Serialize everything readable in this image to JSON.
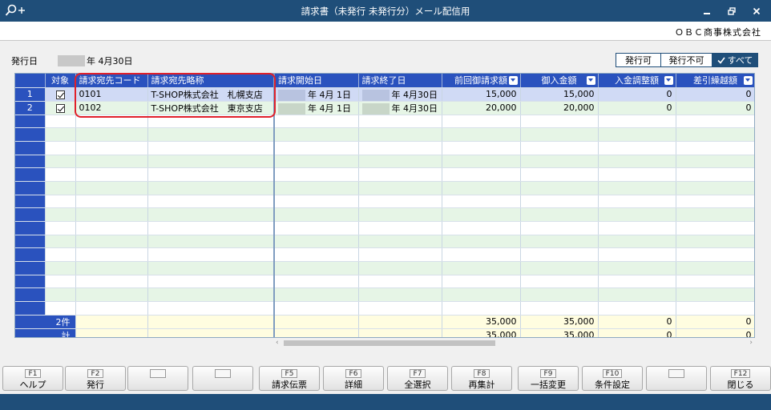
{
  "window": {
    "title": "請求書（未発行 未発行分）メール配信用",
    "company": "ＯＢＣ商事株式会社"
  },
  "issue_date": {
    "label": "発行日",
    "value": "年 4月30日"
  },
  "filters": [
    "発行可",
    "発行不可",
    "すべて"
  ],
  "grid": {
    "columns": [
      "対象",
      "請求宛先コード",
      "請求宛先略称",
      "請求開始日",
      "請求終了日",
      "前回御請求額",
      "御入金額",
      "入金調整額",
      "差引繰越額"
    ],
    "rows": [
      {
        "no": "1",
        "code": "0101",
        "name": "T-SHOP株式会社　札幌支店",
        "start": "年  4月  1日",
        "end": "年  4月30日",
        "prev": "15,000",
        "paid": "15,000",
        "adj": "0",
        "carry": "0"
      },
      {
        "no": "2",
        "code": "0102",
        "name": "T-SHOP株式会社　東京支店",
        "start": "年  4月  1日",
        "end": "年  4月30日",
        "prev": "20,000",
        "paid": "20,000",
        "adj": "0",
        "carry": "0"
      }
    ],
    "totals": [
      {
        "label": "2件",
        "prev": "35,000",
        "paid": "35,000",
        "adj": "0",
        "carry": "0"
      },
      {
        "label": "計",
        "prev": "35,000",
        "paid": "35,000",
        "adj": "0",
        "carry": "0"
      }
    ]
  },
  "fkeys": [
    {
      "key": "F1",
      "label": "ヘルプ"
    },
    {
      "key": "F2",
      "label": "発行"
    },
    {
      "key": "",
      "label": ""
    },
    {
      "key": "",
      "label": ""
    },
    {
      "key": "F5",
      "label": "請求伝票"
    },
    {
      "key": "F6",
      "label": "詳細"
    },
    {
      "key": "F7",
      "label": "全選択"
    },
    {
      "key": "F8",
      "label": "再集計"
    },
    {
      "key": "F9",
      "label": "一括変更"
    },
    {
      "key": "F10",
      "label": "条件設定"
    },
    {
      "key": "",
      "label": ""
    },
    {
      "key": "F12",
      "label": "閉じる"
    }
  ],
  "icons": {
    "app": "search-plus-icon",
    "minimize": "minimize-icon",
    "restore": "restore-icon",
    "close": "close-icon"
  },
  "colors": {
    "titlebar": "#1f4e79",
    "grid_header": "#2a52be",
    "highlight": "#e0202a"
  }
}
